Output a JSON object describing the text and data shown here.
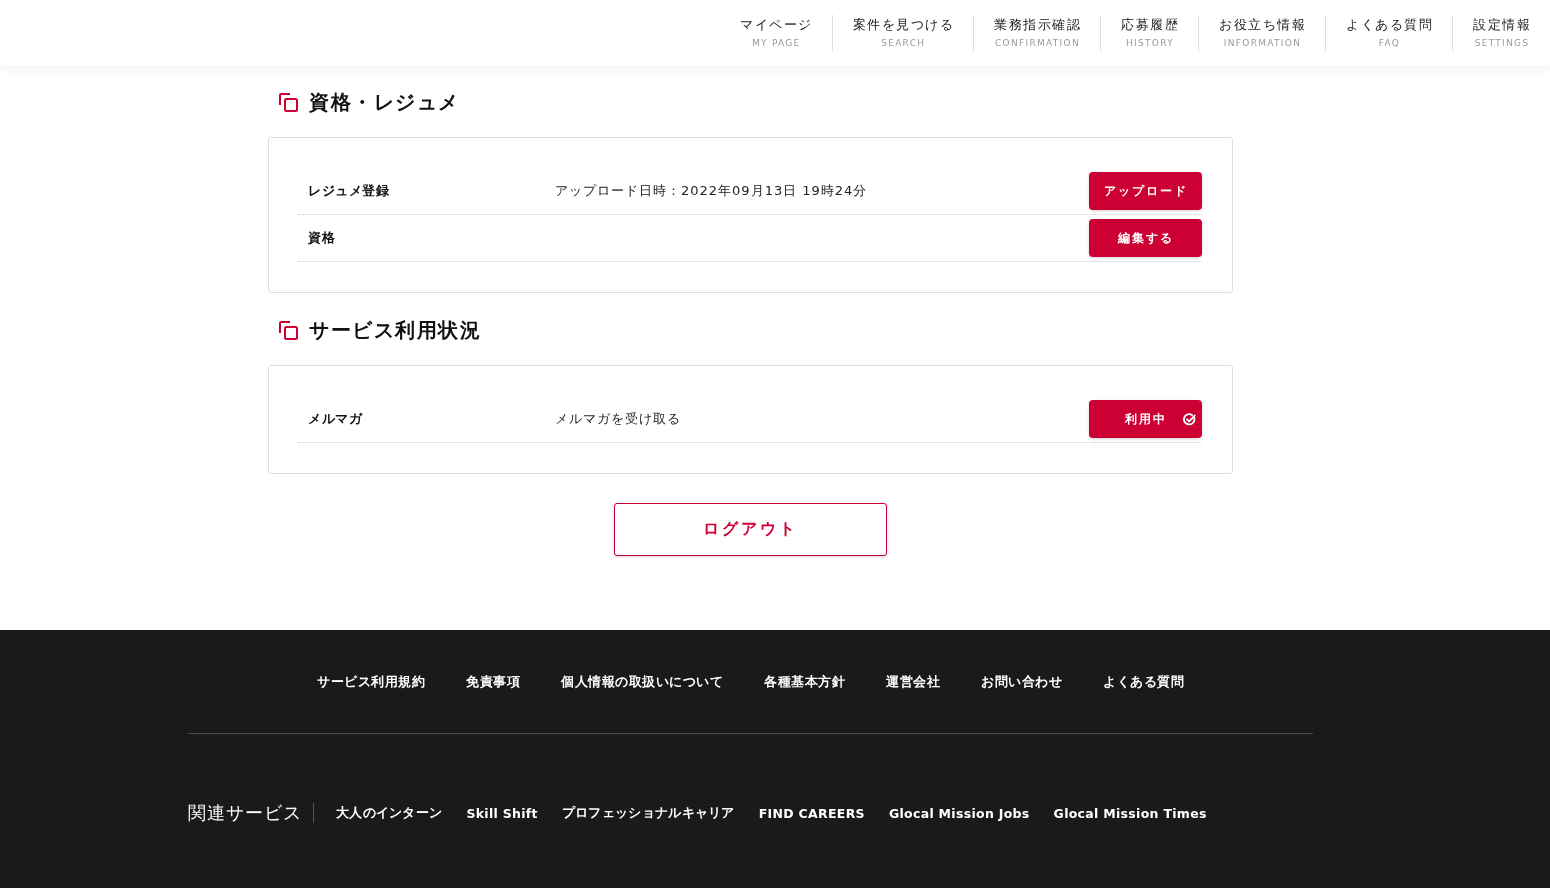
{
  "header": {
    "nav": [
      {
        "label": "マイページ",
        "sublabel": "MY PAGE"
      },
      {
        "label": "案件を見つける",
        "sublabel": "SEARCH"
      },
      {
        "label": "業務指示確認",
        "sublabel": "CONFIRMATION"
      },
      {
        "label": "応募履歴",
        "sublabel": "HISTORY"
      },
      {
        "label": "お役立ち情報",
        "sublabel": "INFORMATION"
      },
      {
        "label": "よくある質問",
        "sublabel": "FAQ"
      },
      {
        "label": "設定情報",
        "sublabel": "SETTINGS"
      }
    ]
  },
  "sections": [
    {
      "title": "資格・レジュメ",
      "rows": [
        {
          "label": "レジュメ登録",
          "value": "アップロード日時：2022年09月13日 19時24分",
          "button": {
            "label": "アップロード"
          }
        },
        {
          "label": "資格",
          "button": {
            "label": "編集する"
          }
        }
      ]
    },
    {
      "title": "サービス利用状況",
      "rows": [
        {
          "label": "メルマガ",
          "value": "メルマガを受け取る",
          "button": {
            "label": "利用中",
            "checked": true
          }
        }
      ]
    }
  ],
  "logout_button": "ログアウト",
  "footer": {
    "links": [
      "サービス利用規約",
      "免責事項",
      "個人情報の取扱いについて",
      "各種基本方針",
      "運営会社",
      "お問い合わせ",
      "よくある質問"
    ],
    "related_services": {
      "title": "関連サービス",
      "links": [
        "大人のインターン",
        "Skill Shift",
        "プロフェッショナルキャリア",
        "FIND CAREERS",
        "Glocal Mission Jobs",
        "Glocal Mission Times"
      ]
    }
  }
}
